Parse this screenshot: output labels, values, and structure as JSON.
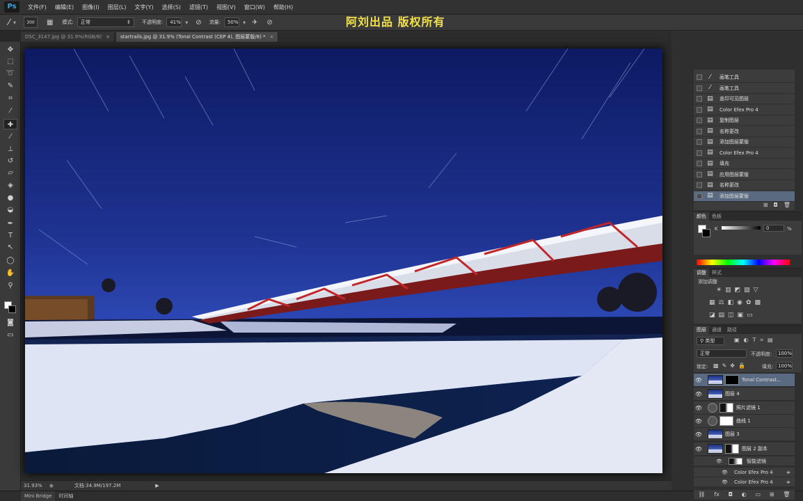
{
  "app": {
    "logo": "Ps"
  },
  "menu": [
    "文件(F)",
    "编辑(E)",
    "图像(I)",
    "图层(L)",
    "文字(Y)",
    "选择(S)",
    "滤镜(T)",
    "视图(V)",
    "窗口(W)",
    "帮助(H)"
  ],
  "watermark": "阿刘出品  版权所有",
  "options": {
    "brush_size": "300",
    "mode_label": "模式:",
    "mode_value": "正常",
    "opacity_label": "不透明度:",
    "opacity_value": "41%",
    "flow_label": "流量:",
    "flow_value": "50%"
  },
  "tabs": [
    {
      "label": "DSC_3147.jpg @ 31.9%(RGB/8)",
      "close": "×"
    },
    {
      "label": "startrails.jpg @ 31.9% (Tonal Contrast (CEP 4), 图层蒙版/8) *",
      "close": "×"
    }
  ],
  "status": {
    "zoom": "31.93%",
    "doc": "文档:34.9M/197.2M"
  },
  "bottom_tabs": [
    "Mini Bridge",
    "时间轴"
  ],
  "history": [
    {
      "label": "画笔工具",
      "icon": "brush-icon"
    },
    {
      "label": "画笔工具",
      "icon": "brush-icon"
    },
    {
      "label": "盖印可见图层",
      "icon": "doc-icon"
    },
    {
      "label": "Color Efex Pro 4",
      "icon": "doc-icon"
    },
    {
      "label": "复制图层",
      "icon": "doc-icon"
    },
    {
      "label": "名称更改",
      "icon": "doc-icon"
    },
    {
      "label": "添加图层蒙版",
      "icon": "doc-icon"
    },
    {
      "label": "Color Efex Pro 4",
      "icon": "doc-icon"
    },
    {
      "label": "填充",
      "icon": "doc-icon"
    },
    {
      "label": "应用图层蒙版",
      "icon": "doc-icon"
    },
    {
      "label": "名称更改",
      "icon": "doc-icon"
    },
    {
      "label": "添加图层蒙版",
      "icon": "doc-icon",
      "selected": true
    }
  ],
  "color_panel": {
    "tabs": [
      "颜色",
      "色板"
    ],
    "channel": "K",
    "value": "0",
    "unit": "%"
  },
  "adjust_panel": {
    "tabs": [
      "调整",
      "样式"
    ],
    "title": "添加调整"
  },
  "layers_panel": {
    "tabs": [
      "图层",
      "通道",
      "路径"
    ],
    "filter": "类型",
    "blend": "正常",
    "opacity_label": "不透明度:",
    "opacity": "100%",
    "lock_label": "锁定:",
    "fill_label": "填充:",
    "fill": "100%",
    "layers": [
      {
        "name": "Tonal Contrast...",
        "kind": "photo",
        "mask": "black",
        "selected": true
      },
      {
        "name": "图层 4",
        "kind": "photo"
      },
      {
        "name": "照片滤镜 1",
        "kind": "adjust",
        "mask": "white-dark"
      },
      {
        "name": "曲线 1",
        "kind": "adjust",
        "mask": "white"
      },
      {
        "name": "图层 3",
        "kind": "photo"
      },
      {
        "name": "图层 2 副本",
        "kind": "photo",
        "mask": "white-dark"
      }
    ],
    "sub_items": [
      "智能滤镜",
      "Color Efex Pro 4",
      "Color Efex Pro 4"
    ]
  }
}
